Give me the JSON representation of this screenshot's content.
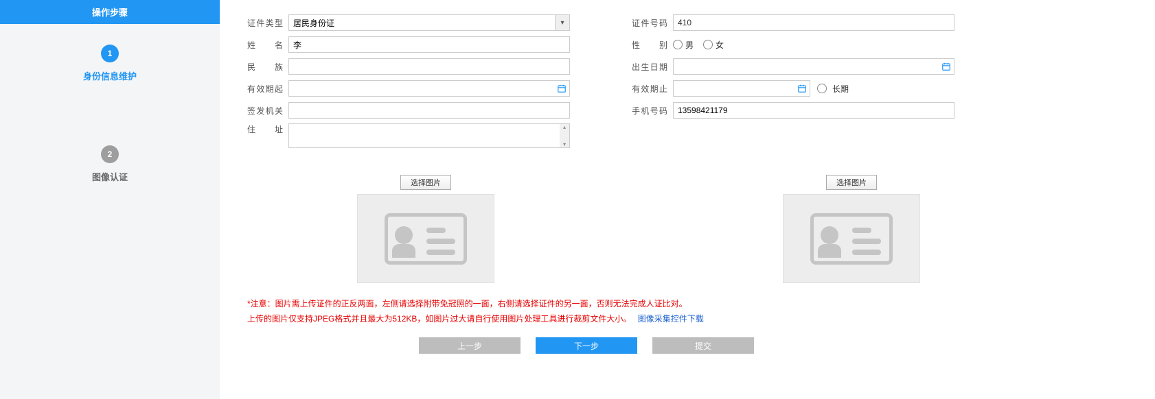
{
  "sidebar": {
    "title": "操作步骤",
    "steps": [
      {
        "num": "1",
        "label": "身份信息维护"
      },
      {
        "num": "2",
        "label": "图像认证"
      }
    ]
  },
  "form": {
    "left": {
      "cert_type_label": "证件类型",
      "cert_type_value": "居民身份证",
      "name_label": "姓　　名",
      "name_value": "李",
      "ethnicity_label": "民　　族",
      "ethnicity_value": "",
      "valid_from_label": "有效期起",
      "valid_from_value": "",
      "issuer_label": "签发机关",
      "issuer_value": "",
      "address_label": "住　　址",
      "address_value": ""
    },
    "right": {
      "cert_no_label": "证件号码",
      "cert_no_prefix": "410",
      "gender_label": "性　　别",
      "gender_male": "男",
      "gender_female": "女",
      "birth_label": "出生日期",
      "birth_value": "",
      "valid_to_label": "有效期止",
      "valid_to_value": "",
      "long_term_label": "长期",
      "phone_label": "手机号码",
      "phone_value": "13598421179"
    }
  },
  "upload": {
    "select_button": "选择图片"
  },
  "notes": {
    "line1": "*注意：图片需上传证件的正反两面，左侧请选择附带免冠照的一面，右侧请选择证件的另一面，否则无法完成人证比对。",
    "line2_prefix": "上传的图片仅支持JPEG格式并且最大为512KB，如图片过大请自行使用图片处理工具进行裁剪文件大小。",
    "line2_link": "图像采集控件下载"
  },
  "buttons": {
    "prev": "上一步",
    "next": "下一步",
    "submit": "提交"
  }
}
